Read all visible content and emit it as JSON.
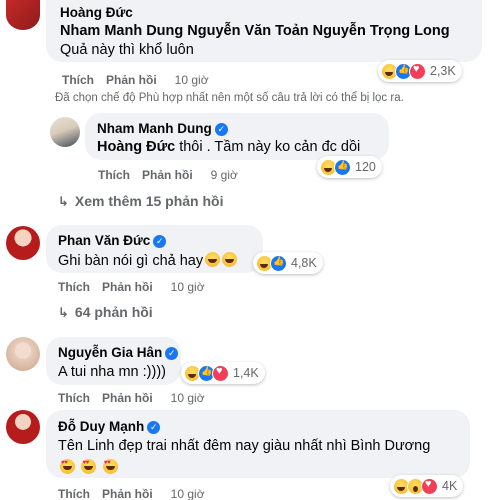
{
  "comments": [
    {
      "author": "Hoàng Đức",
      "text_mentions": "Nham Manh Dung Nguyễn Văn Toản Nguyễn Trọng Long",
      "text_body": " Quả này thì khổ luôn",
      "actions": {
        "like": "Thích",
        "reply": "Phản hồi",
        "time": "10 giờ"
      },
      "reaction_count": "2,3K"
    },
    {
      "author": "Nham Manh Dung",
      "text_mentions": "Hoàng Đức",
      "text_body": " thôi . Tầm này ko cản đc dồi",
      "actions": {
        "like": "Thích",
        "reply": "Phản hồi",
        "time": "9 giờ"
      },
      "reaction_count": "120"
    },
    {
      "author": "Phan Văn Đức",
      "text_body": "Ghi bàn nói gì chả hay",
      "actions": {
        "like": "Thích",
        "reply": "Phản hồi",
        "time": "10 giờ"
      },
      "reaction_count": "4,8K"
    },
    {
      "author": "Nguyễn Gia Hân",
      "text_body": "A tui nha mn :))))",
      "actions": {
        "like": "Thích",
        "reply": "Phản hồi",
        "time": "10 giờ"
      },
      "reaction_count": "1,4K"
    },
    {
      "author": "Đỗ Duy Mạnh",
      "text_body": "Tên Linh đẹp trai nhất đêm nay giàu nhất nhì Bình Dương",
      "actions": {
        "like": "Thích",
        "reply": "Phản hồi",
        "time": "10 giờ"
      },
      "reaction_count": "4K"
    }
  ],
  "filter_note": "Đã chọn chế độ Phù hợp nhất nên một số câu trả lời có thể bị lọc ra.",
  "more_replies_1": "Xem thêm 15 phản hồi",
  "more_replies_2": "64 phản hồi",
  "colors": {
    "bubble": "#f0f2f5",
    "meta": "#65676b",
    "verified": "#1877f2"
  }
}
